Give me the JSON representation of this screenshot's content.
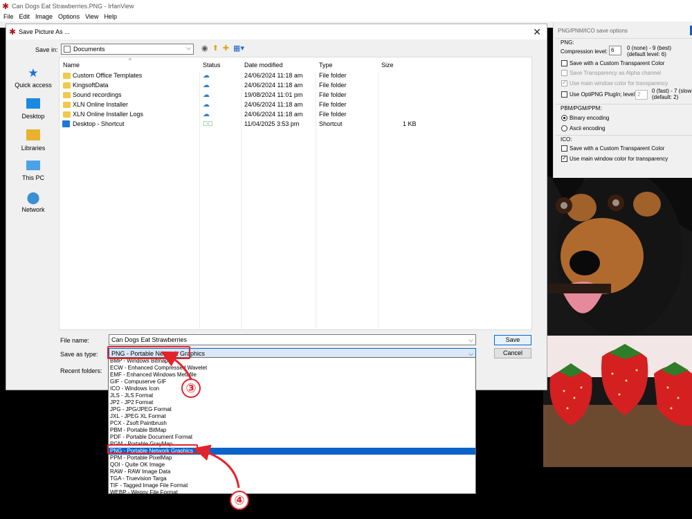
{
  "app": {
    "title": "Can Dogs Eat Strawberries.PNG - IrfanView",
    "menu": [
      "File",
      "Edit",
      "Image",
      "Options",
      "View",
      "Help"
    ]
  },
  "dialog": {
    "title": "Save Picture As ...",
    "close_glyph": "✕",
    "save_in_label": "Save in:",
    "save_in_value": "Documents",
    "places": [
      "Quick access",
      "Desktop",
      "Libraries",
      "This PC",
      "Network"
    ],
    "columns": [
      "Name",
      "Status",
      "Date modified",
      "Type",
      "Size"
    ],
    "files": [
      {
        "name": "Custom Office Templates",
        "status": "cloud",
        "date": "24/06/2024 11:18 am",
        "type": "File folder",
        "size": ""
      },
      {
        "name": "KingsoftData",
        "status": "cloud",
        "date": "24/06/2024 11:18 am",
        "type": "File folder",
        "size": ""
      },
      {
        "name": "Sound recordings",
        "status": "cloud",
        "date": "19/08/2024 11:01 pm",
        "type": "File folder",
        "size": ""
      },
      {
        "name": "XLN Online Installer",
        "status": "cloud",
        "date": "24/06/2024 11:18 am",
        "type": "File folder",
        "size": ""
      },
      {
        "name": "XLN Online Installer Logs",
        "status": "cloud",
        "date": "24/06/2024 11:18 am",
        "type": "File folder",
        "size": ""
      },
      {
        "name": "Desktop - Shortcut",
        "status": "synced",
        "date": "11/04/2025 3:53 pm",
        "type": "Shortcut",
        "size": "1 KB"
      }
    ],
    "file_name_label": "File name:",
    "file_name_value": "Can Dogs Eat Strawberries",
    "save_as_type_label": "Save as type:",
    "save_as_type_value": "PNG - Portable Network Graphics",
    "recent_folders_label": "Recent folders:",
    "save_button": "Save",
    "cancel_button": "Cancel",
    "type_options": [
      "BMP - Windows Bitmap",
      "ECW - Enhanced Compressed Wavelet",
      "EMF - Enhanced Windows Metafile",
      "GIF - Compuserve GIF",
      "ICO - Windows Icon",
      "JLS - JLS Format",
      "JP2 - JP2 Format",
      "JPG - JPG/JPEG Format",
      "JXL - JPEG XL Format",
      "PCX - Zsoft Paintbrush",
      "PBM - Portable BitMap",
      "PDF - Portable Document Format",
      "PGM - Portable GrayMap",
      "PNG - Portable Network Graphics",
      "PPM - Portable PixelMap",
      "QOI - Quite OK Image",
      "RAW - RAW Image Data",
      "TGA - Truevision Targa",
      "TIF - Tagged Image File Format",
      "WEBP - Weppy File Format"
    ],
    "selected_option_index": 13
  },
  "png_options": {
    "title": "PNG/PNM/ICO save options",
    "png_group": "PNG:",
    "compression_label": "Compression level:",
    "compression_value": "6",
    "compression_hint_1": "0 (none) - 9 (best)",
    "compression_hint_2": "(default level: 6)",
    "custom_transparent": "Save with a Custom Transparent Color",
    "alpha_channel": "Save Transparency as Alpha channel",
    "main_window_color": "Use main window color for transparency",
    "optipng_label": "Use OptiPNG PlugIn; level",
    "optipng_value": "2",
    "optipng_hint_1": "0 (fast) - 7 (slow)",
    "optipng_hint_2": "(default: 2)",
    "pbm_group": "PBM/PGM/PPM:",
    "binary_encoding": "Binary encoding",
    "ascii_encoding": "Ascii encoding",
    "ico_group": "ICO:",
    "ico_custom_transparent": "Save with a Custom Transparent Color",
    "ico_main_window_color": "Use main window color for transparency"
  },
  "annotations": {
    "step_a": "③",
    "step_b": "④",
    "color": "#e3232b"
  }
}
